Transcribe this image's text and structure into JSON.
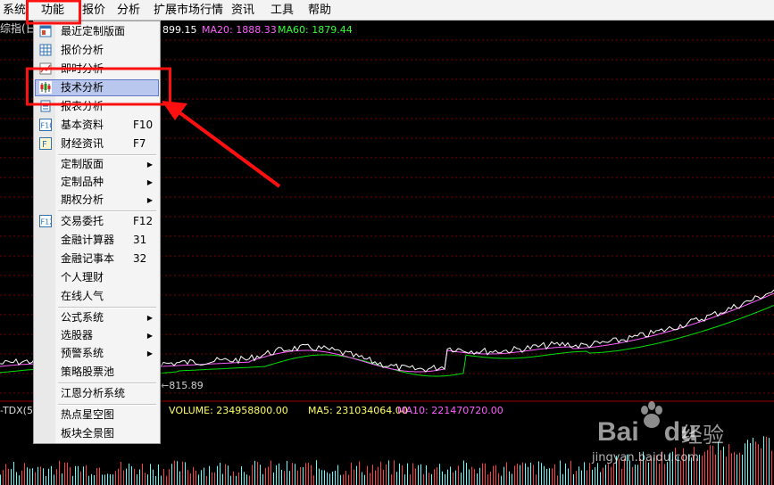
{
  "menubar": [
    {
      "label": "系统"
    },
    {
      "label": "功能"
    },
    {
      "label": "报价"
    },
    {
      "label": "分析"
    },
    {
      "label": "扩展市场行情"
    },
    {
      "label": "资讯"
    },
    {
      "label": "工具"
    },
    {
      "label": "帮助"
    }
  ],
  "chart": {
    "title_fragment": "综指(日",
    "ma_price": "899.15",
    "ma20_label": "MA20: 1888.33",
    "ma60_label": "MA60: 1879.44",
    "low_marker": "←815.89",
    "volume_title_fragment": "-TDX(5",
    "volume_label": "VOLUME: 234958800.00",
    "ma5_label": "MA5: 231034064.00",
    "ma10_label": "MA10: 221470720.00",
    "colors": {
      "price": "#ffffff",
      "ma20": "#ff5fff",
      "ma60": "#00e000",
      "volume_up": "#ff4040",
      "volume_down": "#5fffff",
      "grid": "#7a0000",
      "label_yellow": "#ffff66"
    }
  },
  "dropdown": {
    "items": [
      {
        "label": "最近定制版面",
        "icon": "layout-icon"
      },
      {
        "label": "报价分析",
        "icon": "quote-grid-icon"
      },
      {
        "label": "即时分析",
        "icon": "line-chart-icon"
      },
      {
        "label": "技术分析",
        "icon": "candlestick-icon",
        "selected": true
      },
      {
        "label": "报表分析",
        "icon": "report-icon"
      },
      {
        "label": "基本资料",
        "shortcut": "F10",
        "icon": "f10-icon"
      },
      {
        "label": "财经资讯",
        "shortcut": "F7",
        "icon": "news-icon"
      },
      {
        "label": "定制版面",
        "submenu": true
      },
      {
        "label": "定制品种",
        "submenu": true
      },
      {
        "label": "期权分析",
        "submenu": true
      },
      {
        "label": "交易委托",
        "shortcut": "F12",
        "icon": "f12-icon"
      },
      {
        "label": "金融计算器",
        "shortcut": "31"
      },
      {
        "label": "金融记事本",
        "shortcut": "32"
      },
      {
        "label": "个人理财"
      },
      {
        "label": "在线人气"
      },
      {
        "label": "公式系统",
        "submenu": true
      },
      {
        "label": "选股器",
        "submenu": true
      },
      {
        "label": "预警系统",
        "submenu": true
      },
      {
        "label": "策略股票池"
      },
      {
        "label": "江恩分析系统"
      },
      {
        "label": "热点星空图"
      },
      {
        "label": "板块全景图"
      }
    ]
  },
  "watermark": {
    "brand": "Bai",
    "brand2": "du",
    "product": "经验",
    "url": "jingyan.baidu.com"
  }
}
